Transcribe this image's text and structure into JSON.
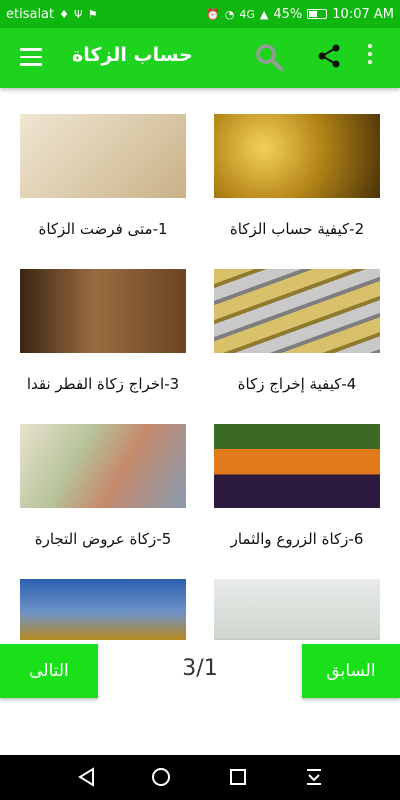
{
  "status_bar": {
    "carrier": "etisalat",
    "battery": "45%",
    "time": "10:07 AM",
    "signal_label": "4G"
  },
  "toolbar": {
    "title": "حساب الزكاة",
    "menu_icon": "hamburger-menu-icon",
    "search_icon": "search-icon",
    "share_icon": "share-icon",
    "more_icon": "more-vertical-icon"
  },
  "items": [
    {
      "label": "1-متى فرضت الزكاة",
      "image": "zakat-calligraphy-coin"
    },
    {
      "label": "2-كيفية حساب الزكاة",
      "image": "gold-coins"
    },
    {
      "label": "3-اخراج زكاة الفطر نقدا",
      "image": "hands-giving-coins"
    },
    {
      "label": "4-كيفية إخراج زكاة",
      "image": "gold-silver-bars"
    },
    {
      "label": "5-زكاة عروض التجارة",
      "image": "banknotes"
    },
    {
      "label": "6-زكاة الزروع والثمار",
      "image": "fruit-vegetable-market"
    },
    {
      "label": "",
      "image": "treasure-gold"
    },
    {
      "label": "",
      "image": "seedling-soil"
    }
  ],
  "pager": {
    "next_label": "التالى",
    "prev_label": "السابق",
    "page_indicator": "3/1"
  },
  "colors": {
    "status_bar": "#0fb80f",
    "toolbar": "#1ed31e",
    "button": "#19e019"
  }
}
